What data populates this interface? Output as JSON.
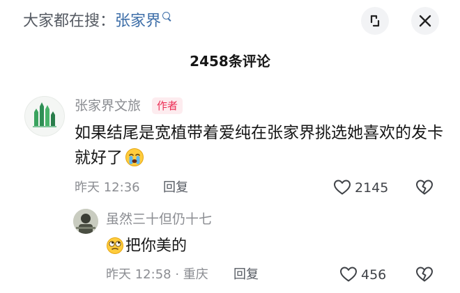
{
  "search": {
    "prefix": "大家都在搜：",
    "keyword": "张家界"
  },
  "header": {
    "comment_count_title": "2458条评论"
  },
  "comment": {
    "author": "张家界文旅",
    "badge": "作者",
    "text": "如果结尾是宽植带着爱纯在张家界挑选她喜欢的发卡就好了",
    "time": "昨天 12:36",
    "reply_label": "回复",
    "likes": "2145"
  },
  "reply": {
    "author": "虽然三十但仍十七",
    "text": "把你美的",
    "time": "昨天 12:58 · 重庆",
    "reply_label": "回复",
    "likes": "456"
  },
  "icons": {
    "search": "search-icon",
    "expand": "expand-icon",
    "close": "close-icon",
    "like": "heart-icon",
    "dislike": "broken-heart-icon",
    "crying": "crying-face-emoji",
    "rolling_eyes": "rolling-eyes-emoji"
  },
  "colors": {
    "keyword": "#3d6ea8",
    "badge_bg": "#fdecef",
    "badge_text": "#ec2d55",
    "secondary_text": "#8b8d92"
  }
}
